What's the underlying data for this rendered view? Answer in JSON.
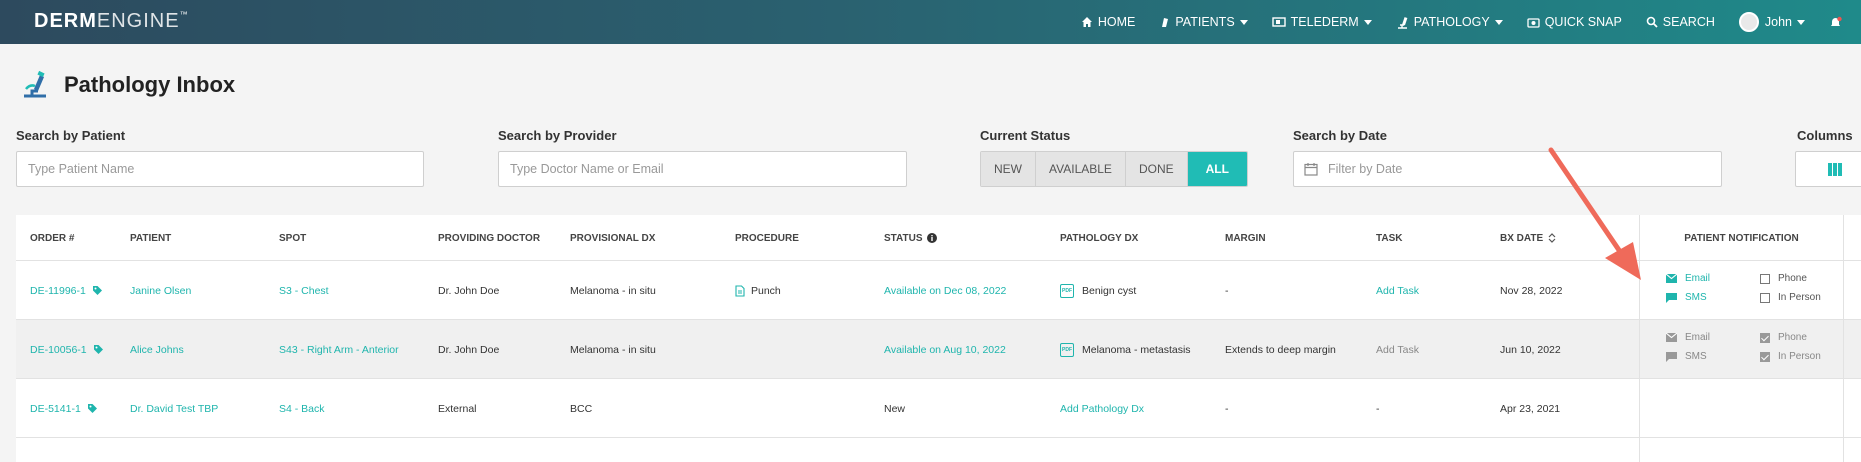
{
  "nav": {
    "logo_bold": "DERM",
    "logo_light": "ENGINE",
    "logo_tm": "™",
    "home": "HOME",
    "patients": "PATIENTS",
    "telederm": "TELEDERM",
    "pathology": "PATHOLOGY",
    "quick_snap": "QUICK SNAP",
    "search": "SEARCH",
    "user": "John"
  },
  "page": {
    "title": "Pathology Inbox"
  },
  "filters": {
    "patient_label": "Search by Patient",
    "patient_placeholder": "Type Patient Name",
    "provider_label": "Search by Provider",
    "provider_placeholder": "Type Doctor Name or Email",
    "status_label": "Current Status",
    "status_options": [
      "NEW",
      "AVAILABLE",
      "DONE",
      "ALL"
    ],
    "date_label": "Search by Date",
    "date_placeholder": "Filter by Date",
    "columns_label": "Columns"
  },
  "table": {
    "headers": {
      "order": "ORDER #",
      "patient": "PATIENT",
      "spot": "SPOT",
      "providing_doctor": "PROVIDING DOCTOR",
      "provisional_dx": "PROVISIONAL DX",
      "procedure": "PROCEDURE",
      "status": "STATUS",
      "pathology_dx": "PATHOLOGY DX",
      "margin": "MARGIN",
      "task": "TASK",
      "bx_date": "BX DATE",
      "patient_notification": "PATIENT NOTIFICATION"
    },
    "rows": [
      {
        "order": "DE-11996-1",
        "patient": "Janine Olsen",
        "spot": "S3 - Chest",
        "providing_doctor": "Dr. John Doe",
        "provisional_dx": "Melanoma - in situ",
        "procedure": "Punch",
        "status": "Available on Dec 08, 2022",
        "pathology_dx": "Benign cyst",
        "margin": "-",
        "task": "Add Task",
        "bx_date": "Nov 28, 2022",
        "notif_email": "Email",
        "notif_sms": "SMS",
        "notif_phone": "Phone",
        "notif_inperson": "In Person"
      },
      {
        "order": "DE-10056-1",
        "patient": "Alice Johns",
        "spot": "S43 - Right Arm - Anterior",
        "providing_doctor": "Dr. John Doe",
        "provisional_dx": "Melanoma - in situ",
        "procedure": "",
        "status": "Available on Aug 10, 2022",
        "pathology_dx": "Melanoma - metastasis",
        "margin": "Extends to deep margin",
        "task": "Add Task",
        "bx_date": "Jun 10, 2022",
        "notif_email": "Email",
        "notif_sms": "SMS",
        "notif_phone": "Phone",
        "notif_inperson": "In Person"
      },
      {
        "order": "DE-5141-1",
        "patient": "Dr. David Test TBP",
        "spot": "S4 - Back",
        "providing_doctor": "External",
        "provisional_dx": "BCC",
        "procedure": "",
        "status": "New",
        "pathology_dx": "Add Pathology Dx",
        "margin": "-",
        "task": "-",
        "bx_date": "Apr 23, 2021"
      }
    ]
  },
  "colors": {
    "accent": "#1fb5ad",
    "annotation_arrow": "#ef6a5a"
  }
}
